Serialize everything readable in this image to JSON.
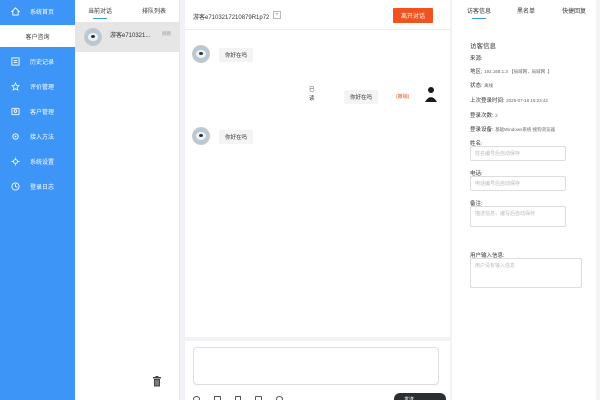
{
  "sidebar": {
    "items": [
      {
        "label": "系统首页",
        "icon": "home-icon",
        "glyph": "⌂"
      },
      {
        "label": "客户咨询",
        "icon": "",
        "glyph": ""
      },
      {
        "label": "历史记录",
        "icon": "history-icon",
        "glyph": "▤"
      },
      {
        "label": "评价管理",
        "icon": "star-icon",
        "glyph": "☆"
      },
      {
        "label": "客户管理",
        "icon": "customer-icon",
        "glyph": "▣"
      },
      {
        "label": "接入方法",
        "icon": "plug-icon",
        "glyph": "⚙"
      },
      {
        "label": "系统设置",
        "icon": "settings-icon",
        "glyph": "✻"
      },
      {
        "label": "登录日志",
        "icon": "clock-icon",
        "glyph": "◷"
      }
    ]
  },
  "convlist": {
    "tabs": [
      "当前对话",
      "排队列表"
    ],
    "item": {
      "name": "游客e710321...",
      "status": "刚刚"
    },
    "delete_icon": "trash-icon"
  },
  "chat": {
    "visitor_id": "游客e7103217210879R1p72",
    "end_button": "离开对话",
    "messages": [
      {
        "from": "visitor",
        "text": "你好在吗"
      },
      {
        "from": "agent",
        "text": "你好在吗",
        "status": "已读",
        "tag": "(撤销)"
      },
      {
        "from": "visitor",
        "text": "你好在吗"
      }
    ],
    "toolbar_icons": [
      "emoji-icon",
      "image-icon",
      "file-icon",
      "quick-reply-icon",
      "history-icon"
    ],
    "send_label": "发送"
  },
  "right": {
    "tabs": [
      "访客信息",
      "黑名单",
      "快捷回复"
    ],
    "section_title": "访客信息",
    "source_label": "来源:",
    "region_label": "地区:",
    "region_value": "192.168.1.3 【局域网，局域网 .】",
    "status_label": "状态:",
    "status_value": "离线",
    "last_login_label": "上次登录时间:",
    "last_login_value": "2025-07-18 15:23:42",
    "login_count_label": "登录次数:",
    "login_count_value": "2",
    "device_label": "登录设备:",
    "device_value": "基础Windows系统 搜狗浏览器",
    "name_label": "姓名:",
    "name_placeholder": "姓名编号后自动保存",
    "phone_label": "电话:",
    "phone_placeholder": "电话编号后自动保存",
    "note_label": "备注:",
    "note_placeholder": "描述信息，编写后自动保存",
    "userinfo_label": "用户输入信息:",
    "userinfo_placeholder": "用户没有输入信息"
  }
}
